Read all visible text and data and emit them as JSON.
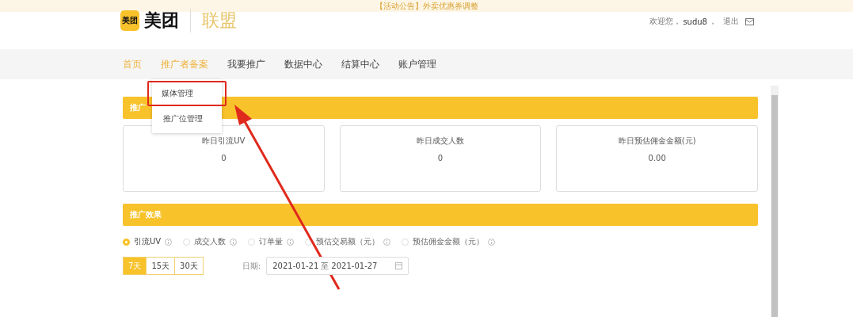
{
  "banner": {
    "text": "【活动公告】外卖优惠券调整"
  },
  "header": {
    "logo_badge": "美团",
    "logo_text": "美团",
    "product": "联盟",
    "welcome": "欢迎您，",
    "username": "sudu8",
    "separator": "，",
    "logout": "退出"
  },
  "nav": [
    {
      "label": "首页",
      "selected": true
    },
    {
      "label": "推广者备案",
      "selected": true
    },
    {
      "label": "我要推广",
      "selected": false
    },
    {
      "label": "数据中心",
      "selected": false
    },
    {
      "label": "结算中心",
      "selected": false
    },
    {
      "label": "账户管理",
      "selected": false
    }
  ],
  "dropdown": [
    {
      "label": "媒体管理",
      "highlighted": true
    },
    {
      "label": "推广位管理",
      "highlighted": false
    }
  ],
  "overview": {
    "title": "推广",
    "cards": [
      {
        "label": "昨日引流UV",
        "value": "0"
      },
      {
        "label": "昨日成交人数",
        "value": "0"
      },
      {
        "label": "昨日预估佣金金额(元)",
        "value": "0.00"
      }
    ]
  },
  "effect": {
    "title": "推广效果",
    "metrics": [
      {
        "label": "引流UV",
        "selected": true
      },
      {
        "label": "成交人数",
        "selected": false
      },
      {
        "label": "订单量",
        "selected": false
      },
      {
        "label": "预估交易额（元）",
        "selected": false
      },
      {
        "label": "预估佣金金额（元）",
        "selected": false
      }
    ],
    "ranges": [
      {
        "label": "7天",
        "selected": true
      },
      {
        "label": "15天",
        "selected": false
      },
      {
        "label": "30天",
        "selected": false
      }
    ],
    "date_label": "日期:",
    "date_from": "2021-01-21",
    "date_sep": "至",
    "date_to": "2021-01-27"
  }
}
